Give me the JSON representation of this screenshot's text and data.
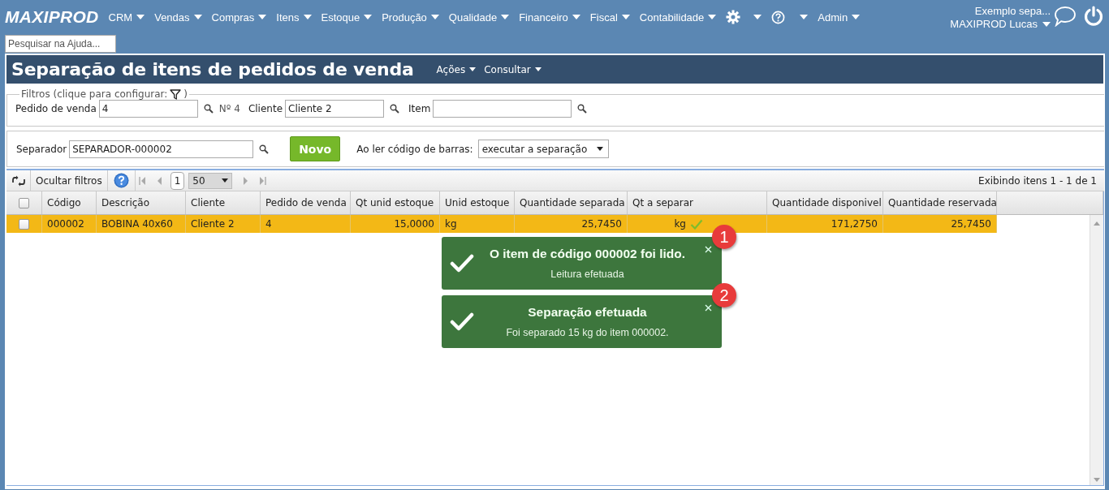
{
  "app": {
    "logo": "MAXIPROD"
  },
  "menu": [
    {
      "kind": "text",
      "label": "CRM"
    },
    {
      "kind": "text",
      "label": "Vendas"
    },
    {
      "kind": "text",
      "label": "Compras"
    },
    {
      "kind": "text",
      "label": "Itens"
    },
    {
      "kind": "text",
      "label": "Estoque"
    },
    {
      "kind": "text",
      "label": "Produção"
    },
    {
      "kind": "text",
      "label": "Qualidade"
    },
    {
      "kind": "text",
      "label": "Financeiro"
    },
    {
      "kind": "text",
      "label": "Fiscal"
    },
    {
      "kind": "text",
      "label": "Contabilidade"
    },
    {
      "kind": "settings"
    },
    {
      "kind": "help"
    },
    {
      "kind": "text",
      "label": "Admin"
    }
  ],
  "user": {
    "workspace": "Exemplo sepa...",
    "name": "MAXIPROD Lucas"
  },
  "help_search": {
    "placeholder": "Pesquisar na Ajuda..."
  },
  "page": {
    "title": "Separação de itens de pedidos de venda",
    "actions": [
      "Ações",
      "Consultar"
    ]
  },
  "filters": {
    "legend": "Filtros (clique para configurar:",
    "legend_close": ")",
    "fields": [
      {
        "label": "Pedido de venda",
        "value": "4",
        "note": "Nº 4"
      },
      {
        "label": "Cliente",
        "value": "Cliente 2"
      },
      {
        "label": "Item"
      }
    ]
  },
  "separation": {
    "separator_label": "Separador",
    "separator_value": "SEPARADOR-000002",
    "new_button": "Novo",
    "barcode_label": "Ao ler código de barras:",
    "barcode_action": "executar a separação"
  },
  "toolbar": {
    "hide_filters": "Ocultar filtros",
    "page": "1",
    "page_size": "50",
    "summary": "Exibindo itens 1 - 1 de 1"
  },
  "table": {
    "all_checked": false,
    "columns": [
      {
        "label": "Código",
        "kind": "text"
      },
      {
        "label": "Descrição",
        "kind": "text"
      },
      {
        "label": "Cliente",
        "kind": "text"
      },
      {
        "label": "Pedido de venda",
        "kind": "text"
      },
      {
        "label": "Qt unid estoque",
        "kind": "number"
      },
      {
        "label": "Unid estoque",
        "kind": "text"
      },
      {
        "label": "Quantidade separada",
        "kind": "number"
      },
      {
        "label": "Qt a separar",
        "kind": "number"
      },
      {
        "label": "Quantidade disponivel",
        "kind": "number"
      },
      {
        "label": "Quantidade reservada",
        "kind": "number"
      }
    ],
    "rows": [
      {
        "selected": true,
        "checked": false,
        "confirmed": true,
        "cells": [
          "000002",
          "BOBINA 40x60",
          "Cliente 2",
          "4",
          "15,0000",
          "kg",
          "25,7450",
          "kg",
          "171,2750",
          "25,7450"
        ]
      }
    ]
  },
  "notifications": [
    {
      "title": "O item de código 000002 foi lido.",
      "message": "Leitura efetuada",
      "badge": "1"
    },
    {
      "title": "Separação efetuada",
      "message": "Foi separado 15 kg do item 000002.",
      "badge": "2"
    }
  ]
}
